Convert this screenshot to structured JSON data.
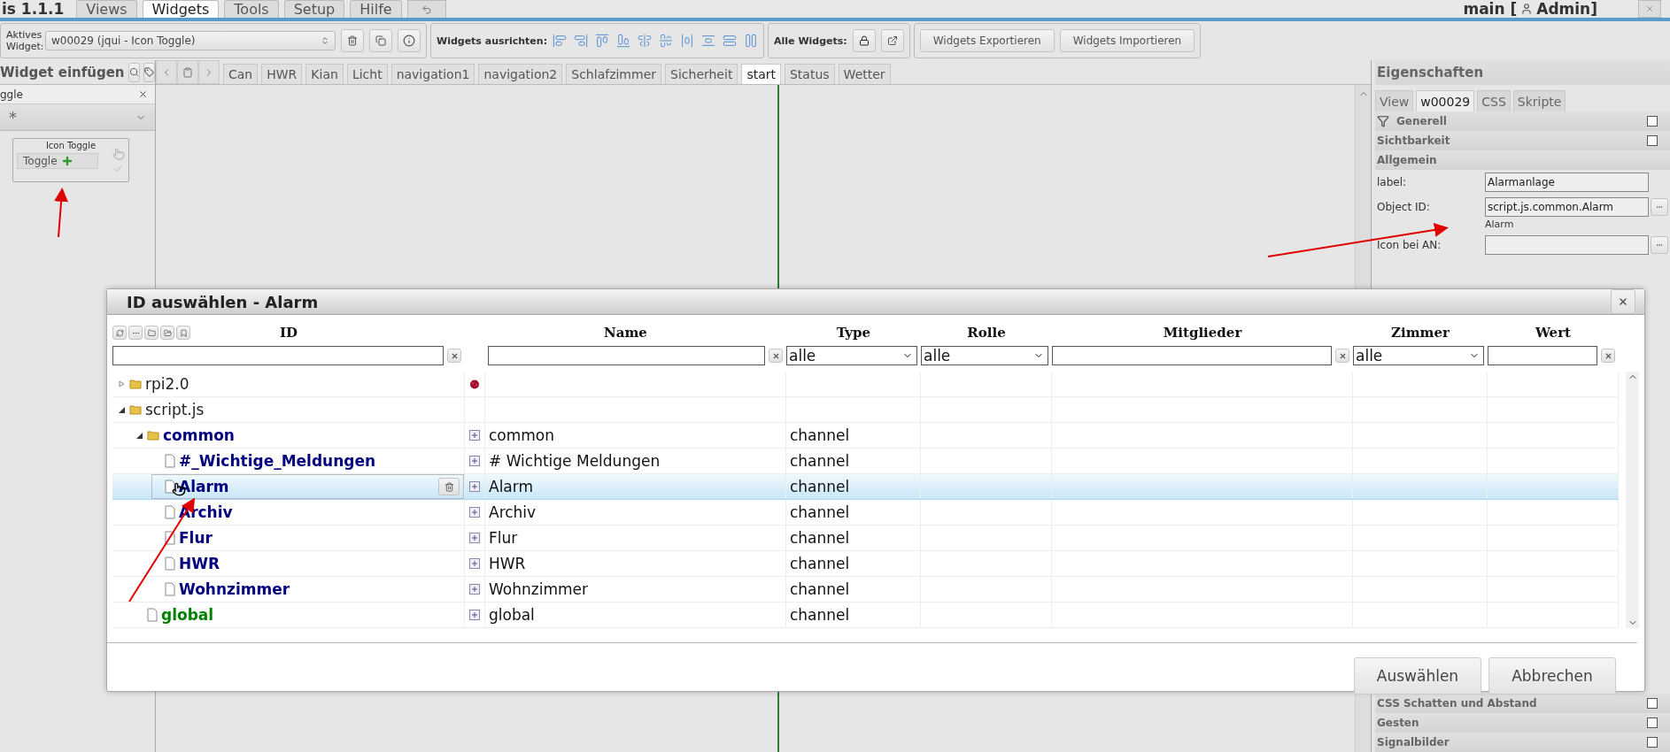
{
  "menu": {
    "app_title": "is 1.1.1",
    "tabs": [
      {
        "label": "Views",
        "selected": false
      },
      {
        "label": "Widgets",
        "selected": true
      },
      {
        "label": "Tools",
        "selected": false
      },
      {
        "label": "Setup",
        "selected": false
      },
      {
        "label": "Hilfe",
        "selected": false
      }
    ],
    "user_prefix": "main [",
    "user_name": "Admin]"
  },
  "toolbar": {
    "active_widget_label": "Aktives Widget:",
    "active_widget_value": "w00029 (jqui - Icon Toggle)",
    "align_label": "Widgets ausrichten:",
    "all_label": "Alle Widgets:",
    "buttons": [
      "Widgets Exportieren",
      "Widgets Importieren"
    ]
  },
  "insert_panel": {
    "title": "Widget einfügen",
    "filter_value": "ggle",
    "set_value": "*",
    "widget": {
      "title": "Icon Toggle",
      "button": "Toggle"
    }
  },
  "view_tabs": [
    {
      "label": "Can",
      "selected": false
    },
    {
      "label": "HWR",
      "selected": false
    },
    {
      "label": "Kian",
      "selected": false
    },
    {
      "label": "Licht",
      "selected": false
    },
    {
      "label": "navigation1",
      "selected": false
    },
    {
      "label": "navigation2",
      "selected": false
    },
    {
      "label": "Schlafzimmer",
      "selected": false
    },
    {
      "label": "Sicherheit",
      "selected": false
    },
    {
      "label": "start",
      "selected": true
    },
    {
      "label": "Status",
      "selected": false
    },
    {
      "label": "Wetter",
      "selected": false
    }
  ],
  "properties": {
    "title": "Eigenschaften",
    "tabs": [
      {
        "label": "View",
        "selected": false
      },
      {
        "label": "w00029",
        "selected": true
      },
      {
        "label": "CSS",
        "selected": false
      },
      {
        "label": "Skripte",
        "selected": false
      }
    ],
    "groups_top": [
      {
        "label": "Generell",
        "checked": false
      },
      {
        "label": "Sichtbarkeit",
        "checked": false
      }
    ],
    "section": "Allgemein",
    "fields": [
      {
        "label": "label:",
        "value": "Alarmanlage"
      },
      {
        "label": "Object ID:",
        "value": "script.js.common.Alarm",
        "hint": "Alarm"
      },
      {
        "label": "Icon bei AN:"
      }
    ],
    "groups_bottom": [
      {
        "label": "CSS Schatten und Abstand",
        "checked": false
      },
      {
        "label": "Gesten",
        "checked": false
      },
      {
        "label": "Signalbilder",
        "checked": false
      }
    ]
  },
  "dialog": {
    "title": "ID auswählen - Alarm",
    "columns": [
      "ID",
      "Name",
      "Type",
      "Rolle",
      "Mitglieder",
      "Zimmer",
      "Wert"
    ],
    "filters": {
      "type": "alle",
      "role": "alle",
      "room": "alle"
    },
    "rows": [
      {
        "id": "rpi2.0",
        "kind": "adapter",
        "color": "#222222",
        "expanded": false,
        "selected": false,
        "hovered": false
      },
      {
        "id": "script.js",
        "kind": "folder",
        "color": "#222222",
        "expanded": true,
        "selected": false,
        "hovered": false,
        "children": [
          {
            "id": "common",
            "kind": "folder",
            "color": "#000080",
            "expanded": true,
            "name": "common",
            "type": "channel",
            "selected": false,
            "hovered": false,
            "children": [
              {
                "id": "#_Wichtige_Meldungen",
                "kind": "document",
                "color": "#000080",
                "name": "# Wichtige Meldungen",
                "type": "channel",
                "selected": false,
                "hovered": false
              },
              {
                "id": "Alarm",
                "kind": "document",
                "color": "#000080",
                "name": "Alarm",
                "type": "channel",
                "selected": true,
                "hovered": true
              },
              {
                "id": "Archiv",
                "kind": "document",
                "color": "#000080",
                "name": "Archiv",
                "type": "channel",
                "selected": false,
                "hovered": false
              },
              {
                "id": "Flur",
                "kind": "document",
                "color": "#000080",
                "name": "Flur",
                "type": "channel",
                "selected": false,
                "hovered": false
              },
              {
                "id": "HWR",
                "kind": "document",
                "color": "#000080",
                "name": "HWR",
                "type": "channel",
                "selected": false,
                "hovered": false
              },
              {
                "id": "Wohnzimmer",
                "kind": "document",
                "color": "#000080",
                "name": "Wohnzimmer",
                "type": "channel",
                "selected": false,
                "hovered": false
              }
            ]
          },
          {
            "id": "global",
            "kind": "document",
            "color": "#008000",
            "name": "global",
            "type": "channel",
            "selected": false,
            "hovered": false
          }
        ]
      }
    ],
    "buttons": [
      "Auswählen",
      "Abbrechen"
    ]
  }
}
